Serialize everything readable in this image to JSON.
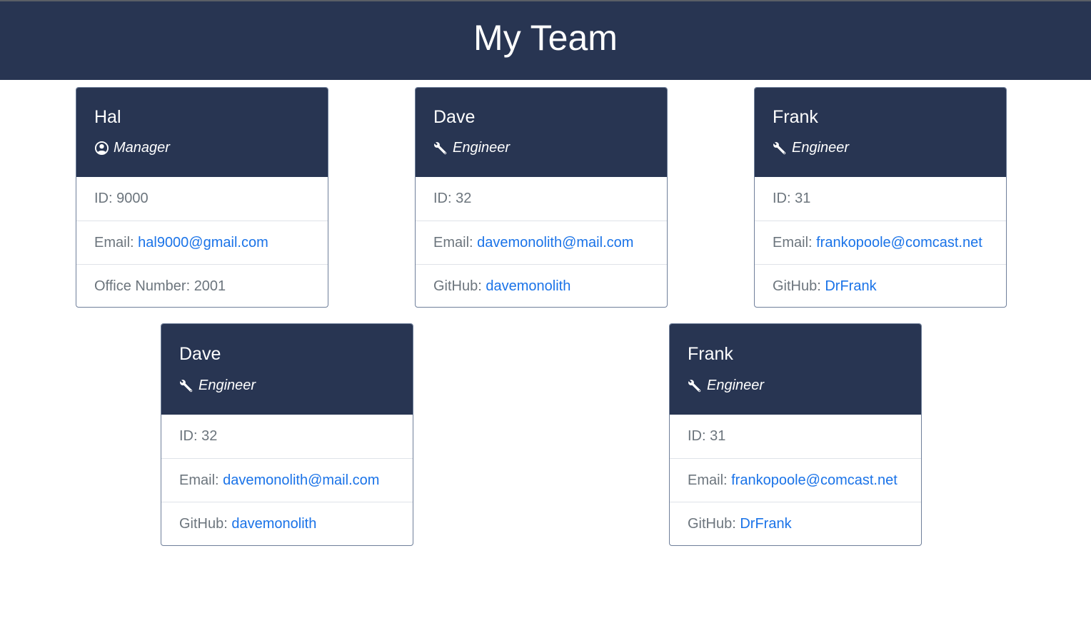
{
  "page": {
    "title": "My Team"
  },
  "cards": [
    {
      "name": "Hal",
      "role": "Manager",
      "icon": "user-circle-icon",
      "id_label": "ID: 9000",
      "email_label": "Email: ",
      "email": "hal9000@gmail.com",
      "extra_label": "Office Number: ",
      "extra_value": "2001"
    },
    {
      "name": "Dave",
      "role": "Engineer",
      "icon": "wrench-icon",
      "id_label": "ID: 32",
      "email_label": "Email: ",
      "email": "davemonolith@mail.com",
      "extra_label": "GitHub: ",
      "extra_value": "davemonolith"
    },
    {
      "name": "Frank",
      "role": "Engineer",
      "icon": "wrench-icon",
      "id_label": "ID: 31",
      "email_label": "Email: ",
      "email": "frankopoole@comcast.net",
      "extra_label": "GitHub: ",
      "extra_value": "DrFrank"
    },
    {
      "name": "Dave",
      "role": "Engineer",
      "icon": "wrench-icon",
      "id_label": "ID: 32",
      "email_label": "Email: ",
      "email": "davemonolith@mail.com",
      "extra_label": "GitHub: ",
      "extra_value": "davemonolith"
    },
    {
      "name": "Frank",
      "role": "Engineer",
      "icon": "wrench-icon",
      "id_label": "ID: 31",
      "email_label": "Email: ",
      "email": "frankopoole@comcast.net",
      "extra_label": "GitHub: ",
      "extra_value": "DrFrank"
    }
  ],
  "colors": {
    "header_bg": "#283552",
    "link": "#1a73e8",
    "muted_text": "#6c757d"
  }
}
